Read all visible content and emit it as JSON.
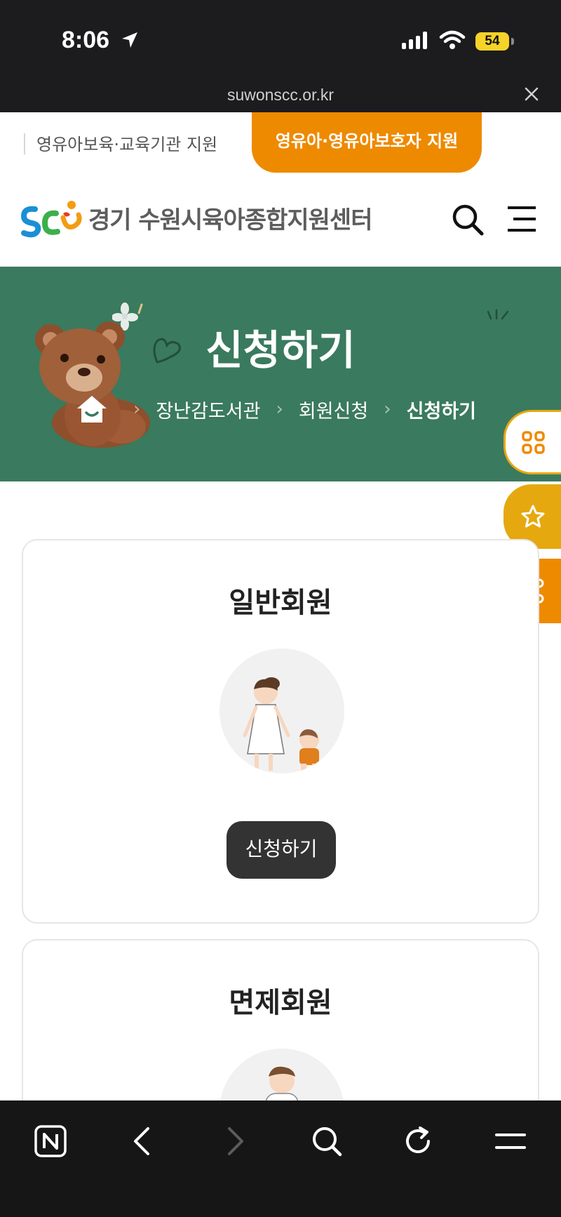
{
  "status_bar": {
    "time": "8:06",
    "battery": "54",
    "url": "suwonscc.or.kr"
  },
  "topbar": {
    "link1": "영유아보육·교육기관 지원",
    "link2": "영유아·영유아보호자 지원"
  },
  "header": {
    "logo_mark": "SCC",
    "site_name": "경기 수원시육아종합지원센터"
  },
  "hero": {
    "title": "신청하기",
    "breadcrumb": [
      "장난감도서관",
      "회원신청",
      "신청하기"
    ]
  },
  "cards": [
    {
      "title": "일반회원",
      "button": "신청하기"
    },
    {
      "title": "면제회원"
    }
  ],
  "colors": {
    "accent_orange": "#ee8a00",
    "hero_green": "#3a7a5e",
    "fab_gold": "#e6a80f",
    "button_dark": "#333333"
  },
  "icons": {
    "header": [
      "search-icon",
      "hamburger-menu-icon"
    ],
    "fabs": [
      "grid-icon",
      "star-icon",
      "share-icon"
    ],
    "toolbar": [
      "naver-n-icon",
      "back-arrow-icon",
      "forward-arrow-icon",
      "search-icon",
      "refresh-icon",
      "menu-icon"
    ]
  }
}
